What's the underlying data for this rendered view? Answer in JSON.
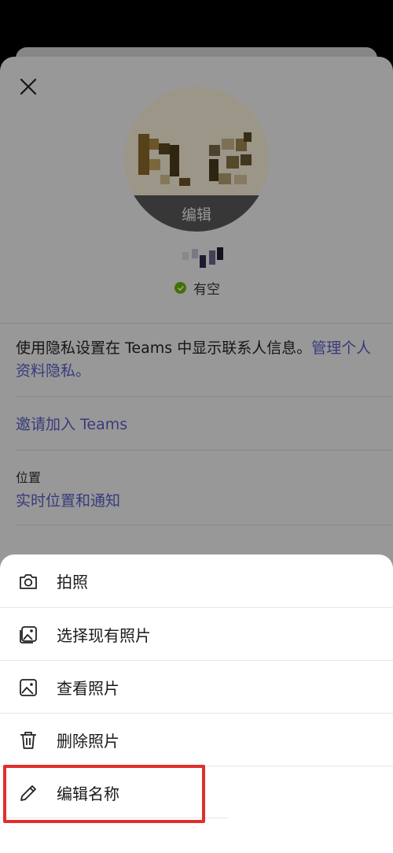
{
  "profile": {
    "avatar_edit_label": "编辑",
    "presence_status": "有空",
    "privacy_text": "使用隐私设置在 Teams 中显示联系人信息。",
    "privacy_link": "管理个人资料隐私。",
    "invite_link": "邀请加入 Teams",
    "location_label": "位置",
    "location_link": "实时位置和通知"
  },
  "action_sheet": {
    "items": [
      {
        "label": "拍照",
        "icon": "camera-icon"
      },
      {
        "label": "选择现有照片",
        "icon": "gallery-icon"
      },
      {
        "label": "查看照片",
        "icon": "image-icon"
      },
      {
        "label": "删除照片",
        "icon": "trash-icon"
      },
      {
        "label": "编辑名称",
        "icon": "pencil-icon"
      }
    ]
  },
  "colors": {
    "accent": "#5b5fc7",
    "presence_available": "#6bb700",
    "highlight": "#e0302c"
  }
}
